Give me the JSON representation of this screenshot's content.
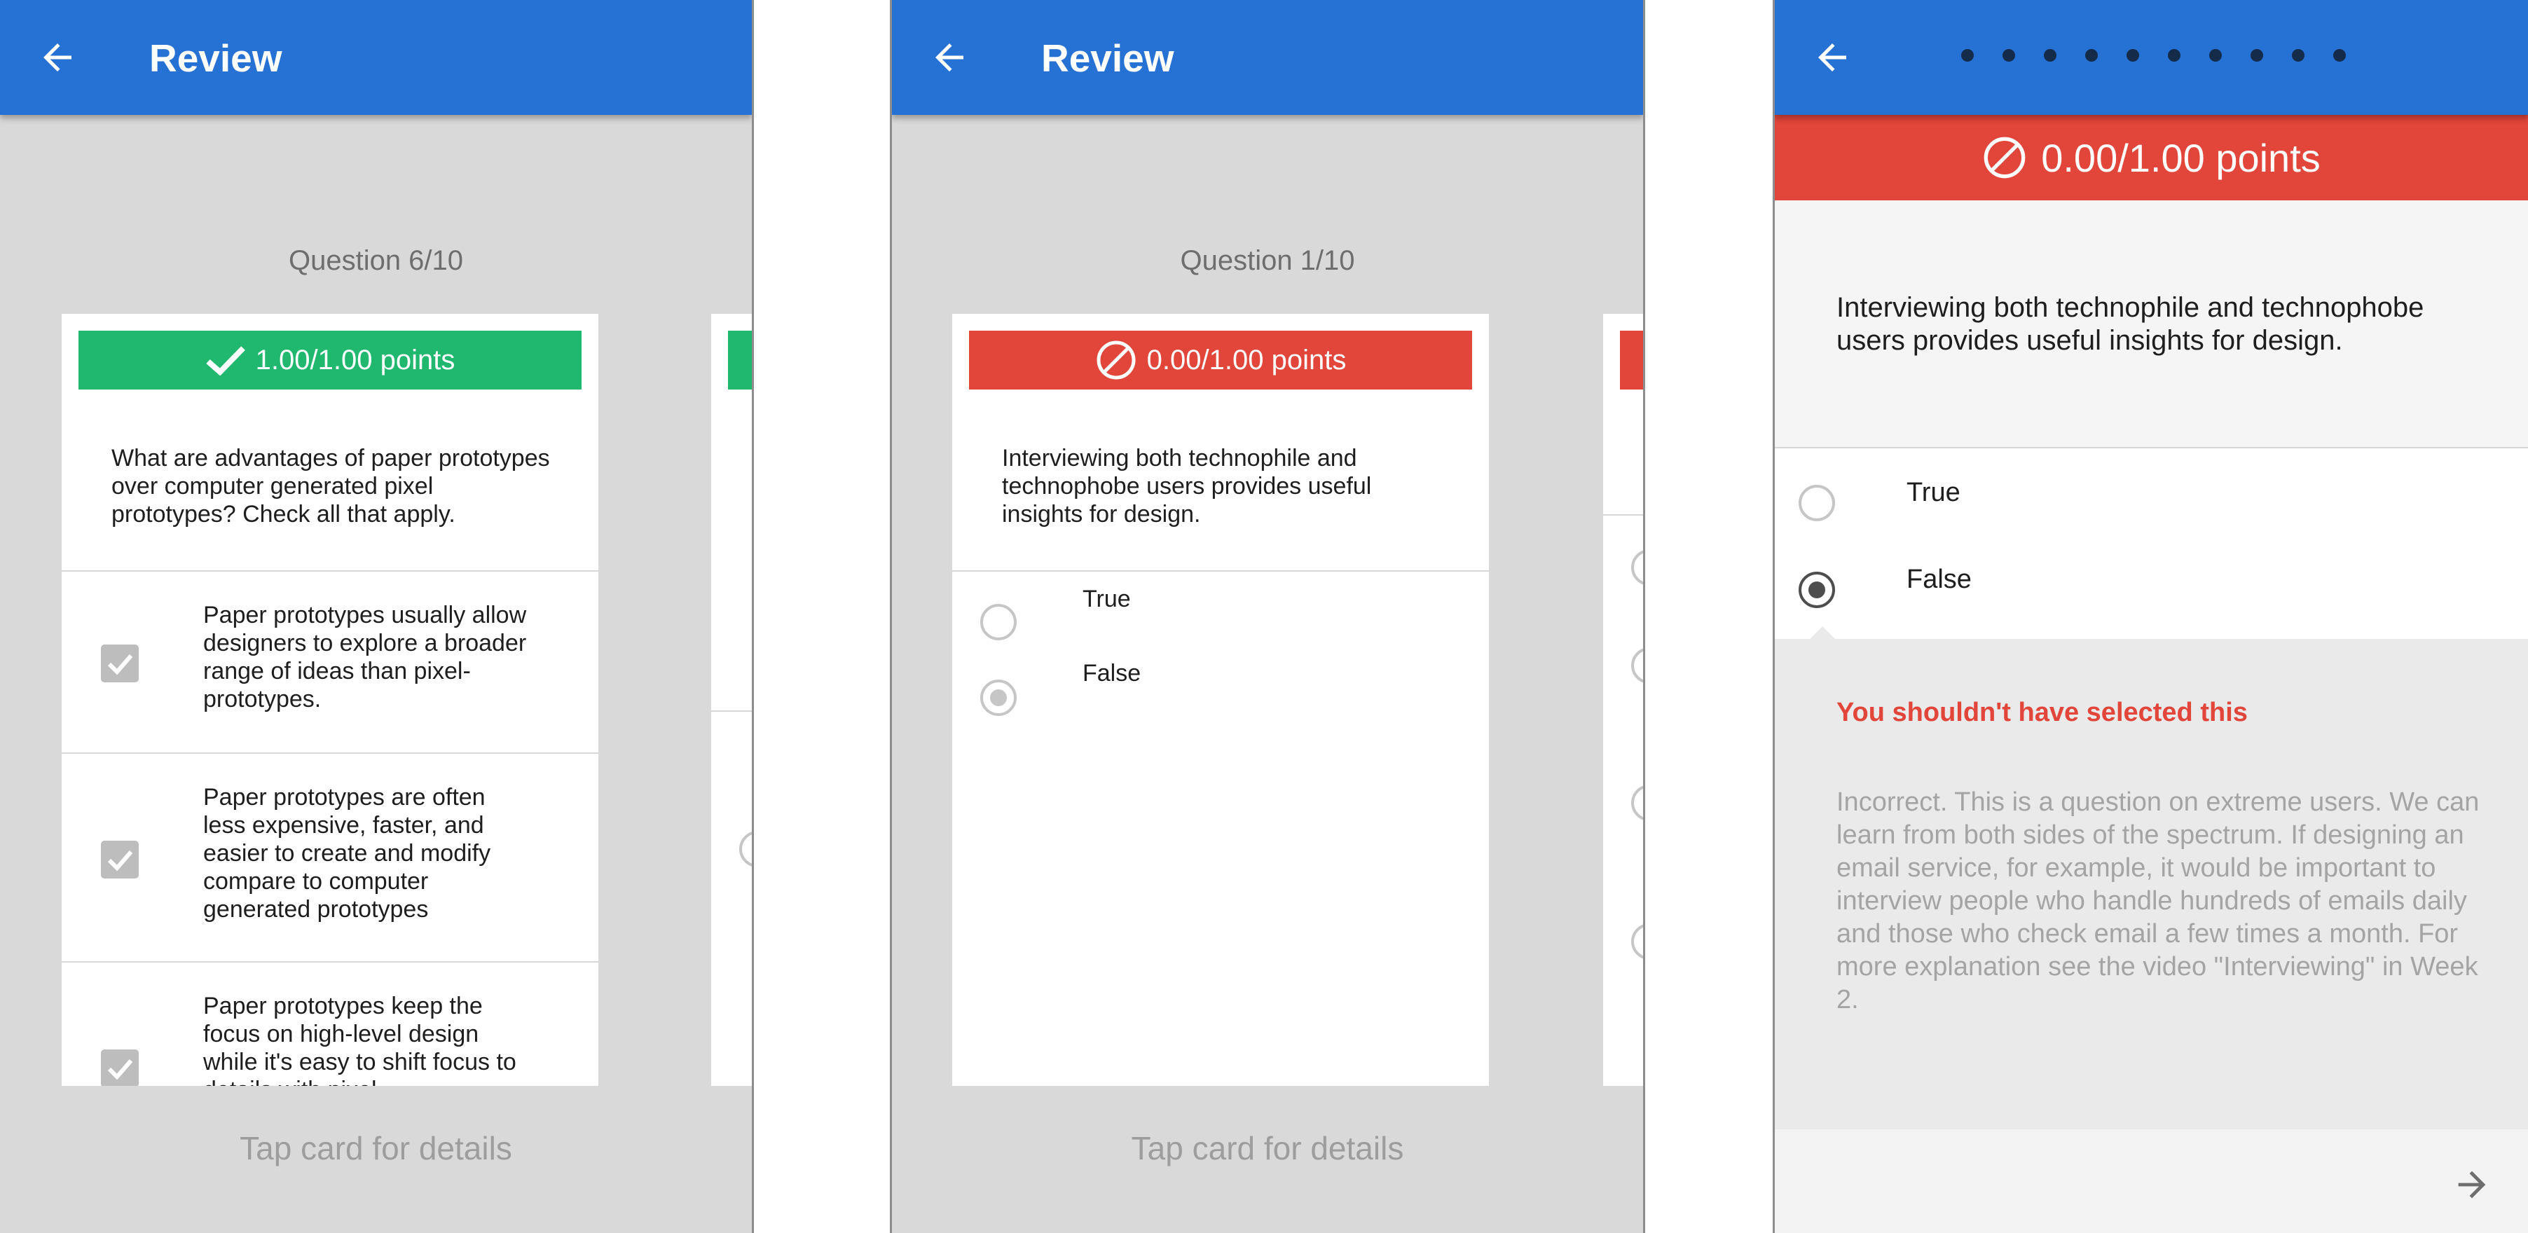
{
  "screens": [
    {
      "title": "Review",
      "question_counter": "Question 6/10",
      "card": {
        "score": "1.00/1.00 points",
        "score_status": "correct",
        "question": "What are advantages of paper prototypes over computer generated pixel prototypes? Check all that apply.",
        "options": [
          {
            "text": "Paper prototypes usually allow designers to explore a broader range of ideas than pixel-prototypes.",
            "checked": true
          },
          {
            "text": "Paper prototypes are often less expensive, faster, and easier to create and modify compare to computer generated prototypes",
            "checked": true
          },
          {
            "text": "Paper prototypes keep the focus on high-level design while it's easy to shift focus to details with pixel",
            "checked": true
          }
        ]
      },
      "hint": "Tap card for details"
    },
    {
      "title": "Review",
      "question_counter": "Question 1/10",
      "card": {
        "score": "0.00/1.00 points",
        "score_status": "incorrect",
        "question": "Interviewing both technophile and technophobe users provides useful insights for design.",
        "options": [
          {
            "text": "True",
            "selected": false
          },
          {
            "text": "False",
            "selected": true
          }
        ]
      },
      "hint": "Tap card for details"
    },
    {
      "progress_dots": 10,
      "score": "0.00/1.00 points",
      "score_status": "incorrect",
      "question": "Interviewing both technophile and technophobe users provides useful insights for design.",
      "options": [
        {
          "text": "True",
          "selected": false
        },
        {
          "text": "False",
          "selected": true
        }
      ],
      "feedback_title": "You shouldn't have selected this",
      "feedback_text": "Incorrect. This is a question on extreme users. We can learn from both sides of the spectrum. If designing an email service, for example, it would be important to interview people who handle hundreds of emails daily and those who check email a few times a month. For more explanation see the video \"Interviewing\" in Week 2."
    }
  ],
  "colors": {
    "app_bar": "#2671d4",
    "correct": "#1fb86e",
    "incorrect": "#e2453a",
    "background": "#d9d9d9"
  },
  "icons": [
    "back-arrow-icon",
    "checkmark-icon",
    "no-entry-icon",
    "forward-arrow-icon",
    "checkbox-checked-icon"
  ]
}
